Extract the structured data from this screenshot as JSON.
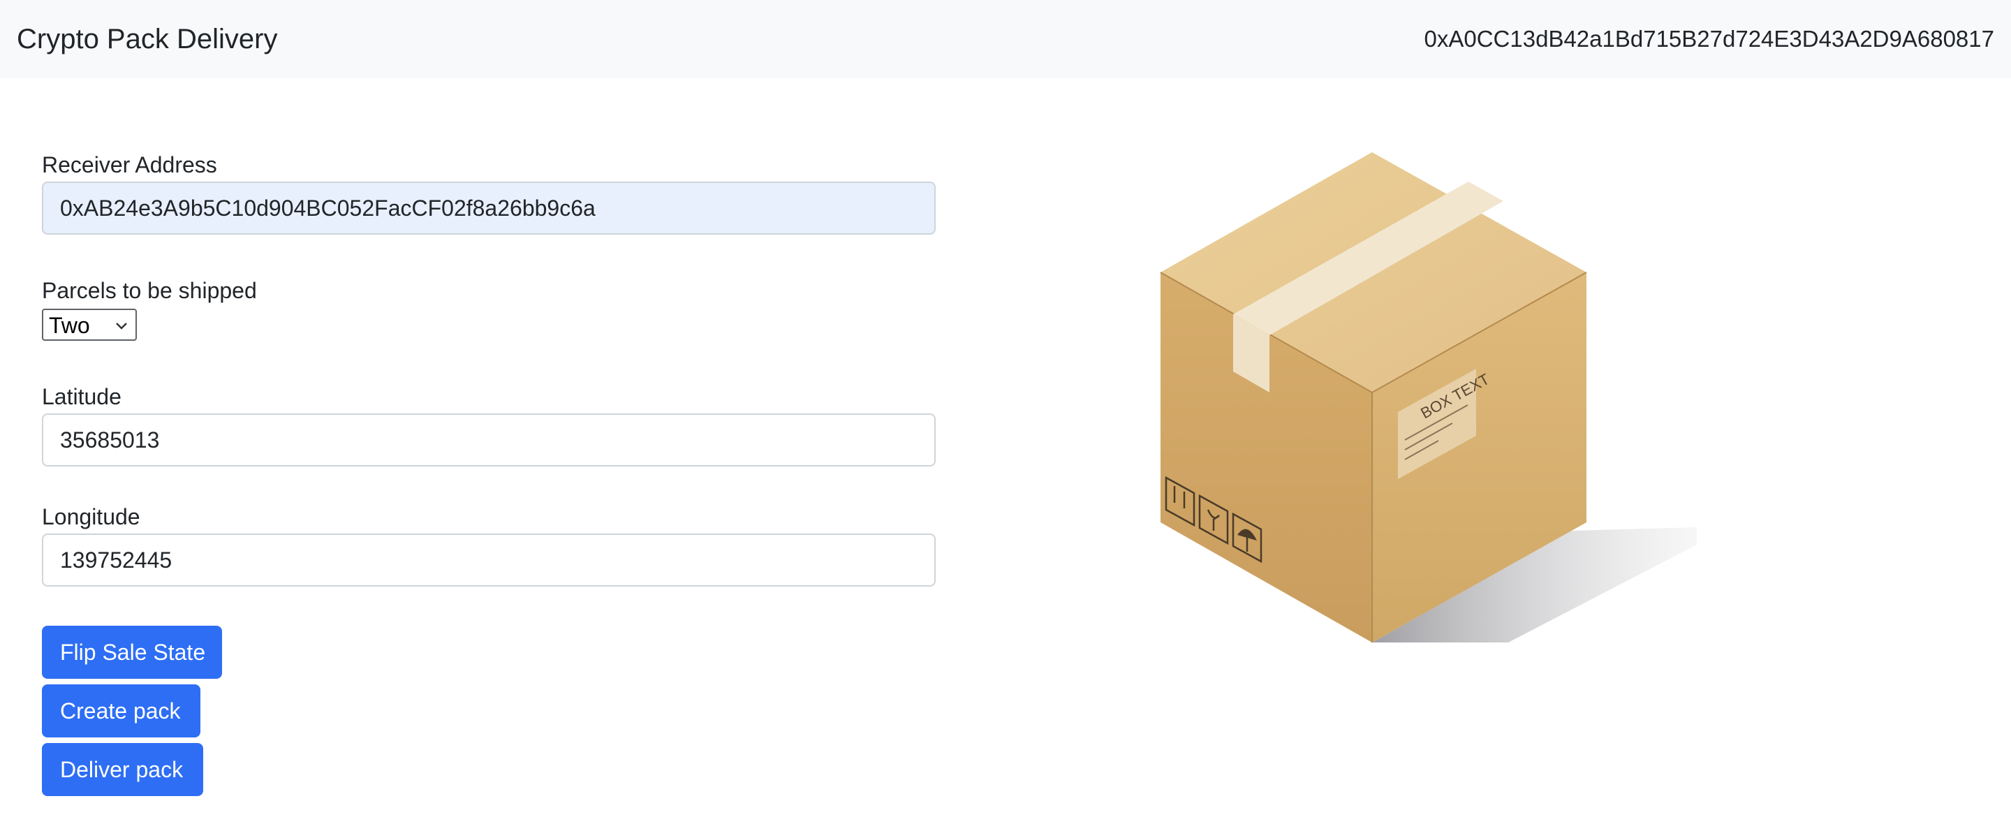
{
  "header": {
    "brand": "Crypto Pack Delivery",
    "account_address": "0xA0CC13dB42a1Bd715B27d724E3D43A2D9A680817"
  },
  "form": {
    "receiver": {
      "label": "Receiver Address",
      "value": "0xAB24e3A9b5C10d904BC052FacCF02f8a26bb9c6a"
    },
    "parcels": {
      "label": "Parcels to be shipped",
      "selected": "Two"
    },
    "latitude": {
      "label": "Latitude",
      "value": "35685013"
    },
    "longitude": {
      "label": "Longitude",
      "value": "139752445"
    }
  },
  "actions": {
    "flip_sale_state": "Flip Sale State",
    "create_pack": "Create pack",
    "deliver_pack": "Deliver pack"
  },
  "illustration": {
    "icon": "cardboard-box-icon",
    "label_text": "BOX TEXT"
  },
  "colors": {
    "primary": "#2d6ef5",
    "navbar_bg": "#f8f9fa",
    "autofill_bg": "#e8f0fe"
  }
}
